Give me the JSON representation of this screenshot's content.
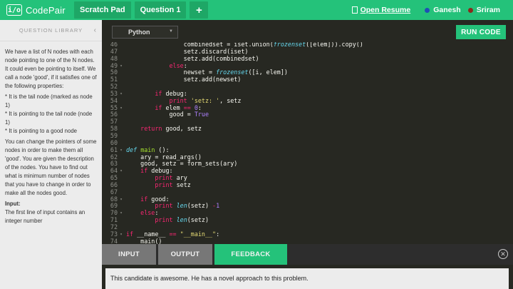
{
  "topbar": {
    "logo_mark": "i/o",
    "logo_text": "CodePair",
    "tabs": [
      "Scratch Pad",
      "Question 1"
    ],
    "add_tab": "+",
    "open_resume": "Open Resume",
    "users": [
      {
        "name": "Ganesh",
        "color": "#1f4fb5"
      },
      {
        "name": "Sriram",
        "color": "#8a2a1c"
      }
    ]
  },
  "sidebar": {
    "title": "QUESTION LIBRARY",
    "collapse_icon": "‹",
    "paragraphs": [
      "We have a list of N nodes with each node pointing to one of the N nodes. It could even be pointing to itself. We call a node 'good', if it satisfies one of the following properties:",
      "* It is the tail node (marked as node 1)",
      "* It is pointing to the tail node (node 1)",
      "* It is pointing to a good node",
      "You can change the pointers of some nodes in order to make them all 'good'. You are given the description of the nodes. You have to find out what is minimum number of nodes that you have to change in order to make all the nodes good."
    ],
    "input_heading": "Input:",
    "input_text": "The first line of input contains an integer number"
  },
  "editor": {
    "language": "Python",
    "run_label": "RUN CODE",
    "lines": [
      {
        "n": "46",
        "f": "",
        "html": "                <span>combinedset = iset.union(</span><span class=\"dk\">frozenset</span><span>([elem])).copy()</span>"
      },
      {
        "n": "47",
        "f": "",
        "html": "                setz.discard(iset)"
      },
      {
        "n": "48",
        "f": "",
        "html": "                setz.add(combinedset)"
      },
      {
        "n": "49",
        "f": "▾",
        "html": "            <span class=\"kw\">else</span>:"
      },
      {
        "n": "50",
        "f": "",
        "html": "                newset = <span class=\"dk\">frozenset</span>([i, elem])"
      },
      {
        "n": "51",
        "f": "",
        "html": "                setz.add(newset)"
      },
      {
        "n": "52",
        "f": "",
        "html": ""
      },
      {
        "n": "53",
        "f": "▾",
        "html": "        <span class=\"kw\">if</span> debug:"
      },
      {
        "n": "54",
        "f": "",
        "html": "            <span class=\"kw\">print</span> <span class=\"st\">'setz: '</span>, setz"
      },
      {
        "n": "55",
        "f": "▾",
        "html": "        <span class=\"kw\">if</span> elem <span class=\"kw\">==</span> <span class=\"nm\">0</span>:"
      },
      {
        "n": "56",
        "f": "",
        "html": "            good = <span class=\"nm\">True</span>"
      },
      {
        "n": "57",
        "f": "",
        "html": ""
      },
      {
        "n": "58",
        "f": "",
        "html": "    <span class=\"kw\">return</span> good, setz"
      },
      {
        "n": "59",
        "f": "",
        "html": ""
      },
      {
        "n": "60",
        "f": "",
        "html": ""
      },
      {
        "n": "61",
        "f": "▾",
        "html": "<span class=\"dk\">def</span> <span class=\"fn\">main</span> ():"
      },
      {
        "n": "62",
        "f": "",
        "html": "    ary = read_args()"
      },
      {
        "n": "63",
        "f": "",
        "html": "    good, setz = form_sets(ary)"
      },
      {
        "n": "64",
        "f": "▾",
        "html": "    <span class=\"kw\">if</span> debug:"
      },
      {
        "n": "65",
        "f": "",
        "html": "        <span class=\"kw\">print</span> ary"
      },
      {
        "n": "66",
        "f": "",
        "html": "        <span class=\"kw\">print</span> setz"
      },
      {
        "n": "67",
        "f": "",
        "html": ""
      },
      {
        "n": "68",
        "f": "▾",
        "html": "    <span class=\"kw\">if</span> good:"
      },
      {
        "n": "69",
        "f": "",
        "html": "        <span class=\"kw\">print</span> <span class=\"dk\">len</span>(setz) <span class=\"kw\">-</span><span class=\"nm\">1</span>"
      },
      {
        "n": "70",
        "f": "▾",
        "html": "    <span class=\"kw\">else</span>:"
      },
      {
        "n": "71",
        "f": "",
        "html": "        <span class=\"kw\">print</span> <span class=\"dk\">len</span>(setz)"
      },
      {
        "n": "72",
        "f": "",
        "html": ""
      },
      {
        "n": "73",
        "f": "▾",
        "html": "<span class=\"kw\">if</span> __name__ <span class=\"kw\">==</span> <span class=\"st\">\"__main__\"</span>:"
      },
      {
        "n": "74",
        "f": "",
        "html": "    main()"
      }
    ]
  },
  "bottom": {
    "tabs": [
      "INPUT",
      "OUTPUT",
      "FEEDBACK"
    ],
    "active_tab": "FEEDBACK",
    "close_icon": "✕",
    "feedback_text": "This candidate is awesome. He has a novel approach to this problem."
  }
}
